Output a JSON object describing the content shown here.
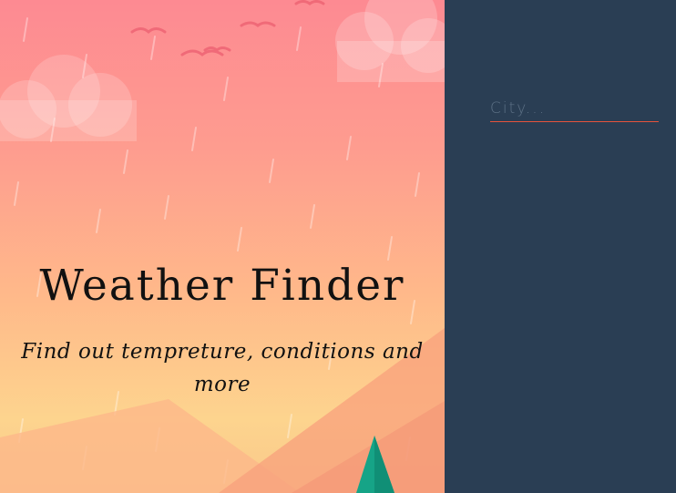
{
  "hero": {
    "title": "Weather Finder",
    "subtitle": "Find out tempreture, conditions and more"
  },
  "search": {
    "placeholder": "City...",
    "value": ""
  },
  "colors": {
    "panel_background": "#2a3e54",
    "input_underline": "#e5533c",
    "hero_top": "#fd8a92",
    "hero_bottom": "#fdd48e",
    "tree": "#16a487"
  },
  "icons": [
    "cloud-icon",
    "bird-icon",
    "mountain-icon",
    "tree-icon",
    "rain-icon"
  ]
}
